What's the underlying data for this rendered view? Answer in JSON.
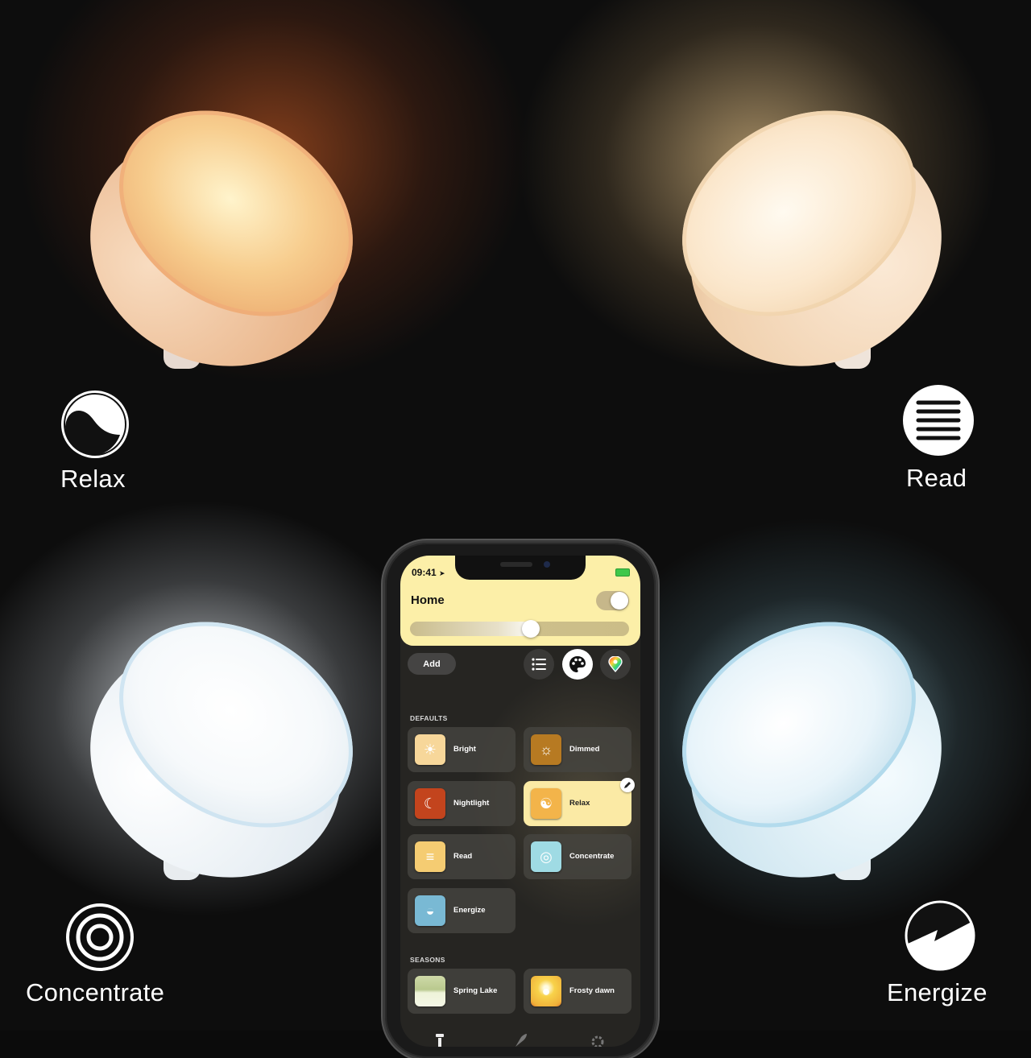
{
  "scenes": {
    "relax": {
      "label": "Relax",
      "icon": "relax-icon"
    },
    "read": {
      "label": "Read",
      "icon": "read-icon"
    },
    "concentrate": {
      "label": "Concentrate",
      "icon": "concentrate-icon"
    },
    "energize": {
      "label": "Energize",
      "icon": "energize-icon"
    }
  },
  "phone": {
    "status_bar": {
      "time": "09:41",
      "location_icon": "location-arrow-icon",
      "battery_icon": "battery-charging-icon"
    },
    "header": {
      "title": "Home",
      "power_on": true,
      "brightness": 0.55
    },
    "toolbar": {
      "add_label": "Add",
      "buttons": [
        {
          "icon": "list-icon",
          "active": false
        },
        {
          "icon": "palette-icon",
          "active": true
        },
        {
          "icon": "color-pin-icon",
          "active": false
        }
      ]
    },
    "sections": [
      {
        "title": "DEFAULTS",
        "scenes": [
          {
            "label": "Bright",
            "icon": "sun-icon",
            "color": "#f7d79a",
            "selected": false
          },
          {
            "label": "Dimmed",
            "icon": "dim-sun-icon",
            "color": "#b77a22",
            "selected": false
          },
          {
            "label": "Nightlight",
            "icon": "moon-icon",
            "color": "#c3441d",
            "selected": false
          },
          {
            "label": "Relax",
            "icon": "relax-icon",
            "color": "#f3b44a",
            "selected": true
          },
          {
            "label": "Read",
            "icon": "read-icon",
            "color": "#f5cc72",
            "selected": false
          },
          {
            "label": "Concentrate",
            "icon": "concentrate-icon",
            "color": "#9fdbe4",
            "selected": false
          },
          {
            "label": "Energize",
            "icon": "energize-icon",
            "color": "#79b9d4",
            "selected": false
          }
        ]
      },
      {
        "title": "SEASONS",
        "scenes": [
          {
            "label": "Spring Lake",
            "icon": "spring-lake-thumbnail",
            "color": "#dfe8c4",
            "selected": false
          },
          {
            "label": "Frosty dawn",
            "icon": "frosty-dawn-thumbnail",
            "color": "#f6c940",
            "selected": false
          }
        ]
      }
    ],
    "tab_bar": [
      "home-lamp-icon",
      "rocket-icon",
      "gear-icon"
    ]
  }
}
